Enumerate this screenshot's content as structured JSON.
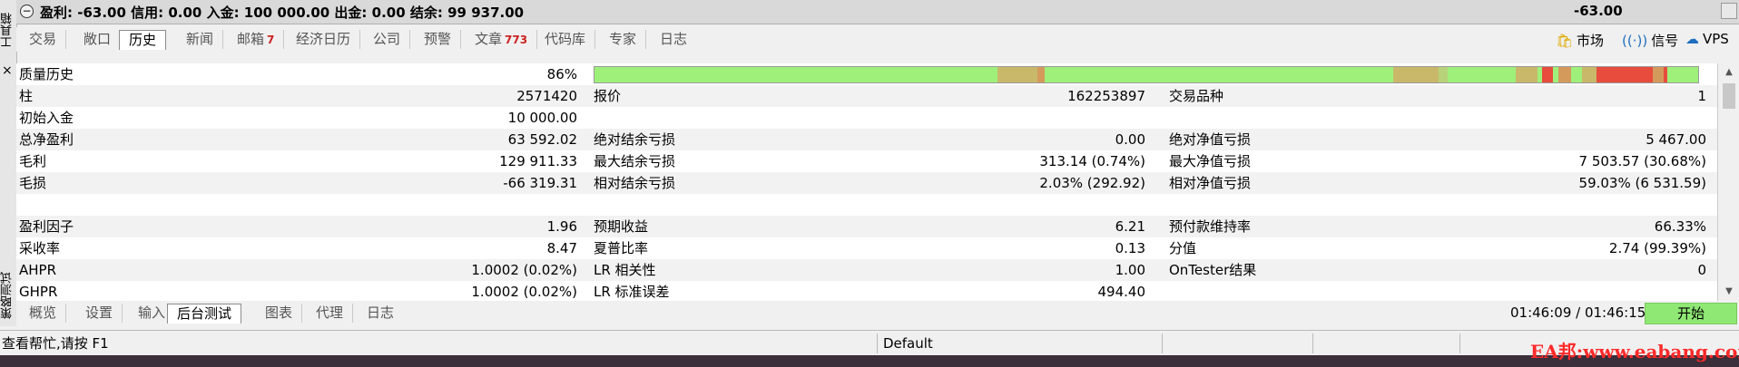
{
  "side_labels": {
    "toolbox": "工具箱",
    "strategy_tester": "策略测试"
  },
  "summary": {
    "text": "盈利: -63.00  信用: 0.00  入金: 100 000.00  出金: 0.00  结余: 99 937.00",
    "profit_right": "-63.00"
  },
  "top_tabs": [
    {
      "label": "交易"
    },
    {
      "label": "敞口"
    },
    {
      "label": "历史"
    },
    {
      "label": "新闻"
    },
    {
      "label": "邮箱",
      "badge": "7"
    },
    {
      "label": "经济日历"
    },
    {
      "label": "公司"
    },
    {
      "label": "预警"
    },
    {
      "label": "文章",
      "badge": "773"
    },
    {
      "label": "代码库"
    },
    {
      "label": "专家"
    },
    {
      "label": "日志"
    }
  ],
  "top_right": {
    "market": "市场",
    "signals": "信号",
    "vps": "VPS"
  },
  "close_label": "×",
  "report": {
    "quality": {
      "label": "质量历史",
      "value": "86%"
    },
    "rows": [
      {
        "c1": "柱",
        "v1": "2571420",
        "c2": "报价",
        "v2": "162253897",
        "c3": "交易品种",
        "v3": "1"
      },
      {
        "c1": "初始入金",
        "v1": "10 000.00",
        "c2": "",
        "v2": "",
        "c3": "",
        "v3": ""
      },
      {
        "c1": "总净盈利",
        "v1": "63 592.02",
        "c2": "绝对结余亏损",
        "v2": "0.00",
        "c3": "绝对净值亏损",
        "v3": "5 467.00"
      },
      {
        "c1": "毛利",
        "v1": "129 911.33",
        "c2": "最大结余亏损",
        "v2": "313.14 (0.74%)",
        "c3": "最大净值亏损",
        "v3": "7 503.57 (30.68%)"
      },
      {
        "c1": "毛损",
        "v1": "-66 319.31",
        "c2": "相对结余亏损",
        "v2": "2.03% (292.92)",
        "c3": "相对净值亏损",
        "v3": "59.03% (6 531.59)"
      },
      {
        "c1": "",
        "v1": "",
        "c2": "",
        "v2": "",
        "c3": "",
        "v3": ""
      },
      {
        "c1": "盈利因子",
        "v1": "1.96",
        "c2": "预期收益",
        "v2": "6.21",
        "c3": "预付款维持率",
        "v3": "66.33%"
      },
      {
        "c1": "采收率",
        "v1": "8.47",
        "c2": "夏普比率",
        "v2": "0.13",
        "c3": "分值",
        "v3": "2.74 (99.39%)"
      },
      {
        "c1": "AHPR",
        "v1": "1.0002 (0.02%)",
        "c2": "LR 相关性",
        "v2": "1.00",
        "c3": "OnTester结果",
        "v3": "0"
      },
      {
        "c1": "GHPR",
        "v1": "1.0002 (0.02%)",
        "c2": "LR 标准误差",
        "v2": "494.40",
        "c3": "",
        "v3": ""
      }
    ]
  },
  "bottom_tabs": [
    {
      "label": "概览"
    },
    {
      "label": "设置"
    },
    {
      "label": "输入"
    },
    {
      "label": "后台测试"
    },
    {
      "label": "图表"
    },
    {
      "label": "代理"
    },
    {
      "label": "日志"
    }
  ],
  "timer": "01:46:09 / 01:46:15",
  "start_button": "开始",
  "status": {
    "help": "查看帮忙,请按 F1",
    "profile": "Default"
  },
  "watermark": "EA邦:www.eabang.com",
  "colors": {
    "quality_good": "#9ff07a",
    "quality_mid": "#c9b86a",
    "quality_bad": "#e84c3d",
    "start_green": "#8fe874",
    "badge_red": "#cc2222"
  }
}
